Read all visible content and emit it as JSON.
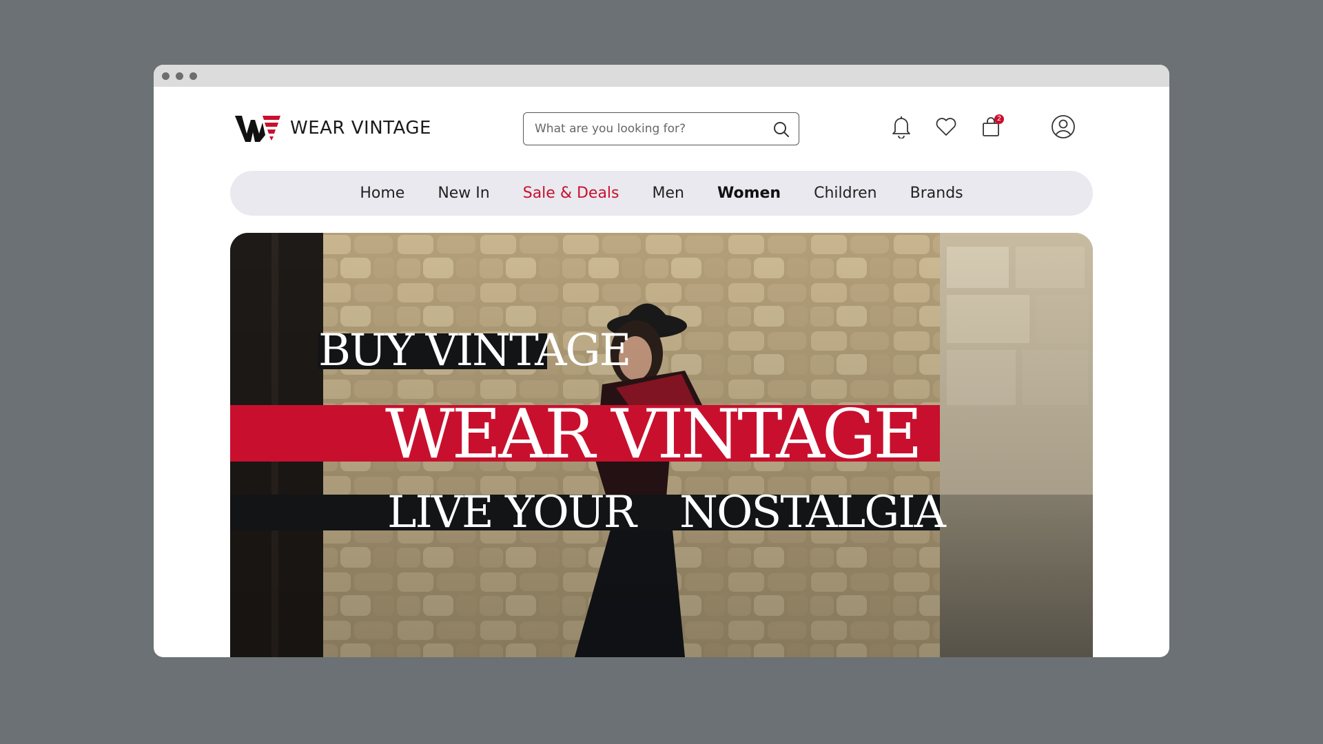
{
  "brand": {
    "name": "WEAR VINTAGE",
    "accent_color": "#c8102e"
  },
  "search": {
    "placeholder": "What are you looking for?",
    "icon": "search-icon"
  },
  "header_icons": {
    "notifications": "bell-icon",
    "wishlist": "heart-icon",
    "cart": "shopping-bag-icon",
    "cart_count": "2",
    "account": "user-circle-icon"
  },
  "nav": {
    "items": [
      {
        "label": "Home"
      },
      {
        "label": "New In"
      },
      {
        "label": "Sale & Deals"
      },
      {
        "label": "Men"
      },
      {
        "label": "Women"
      },
      {
        "label": "Children"
      },
      {
        "label": "Brands"
      }
    ],
    "active": "Women"
  },
  "hero": {
    "line1": "BUY VINTAGE",
    "line2": "WEAR VINTAGE",
    "line3a": "LIVE YOUR",
    "line3b": "NOSTALGIA"
  }
}
